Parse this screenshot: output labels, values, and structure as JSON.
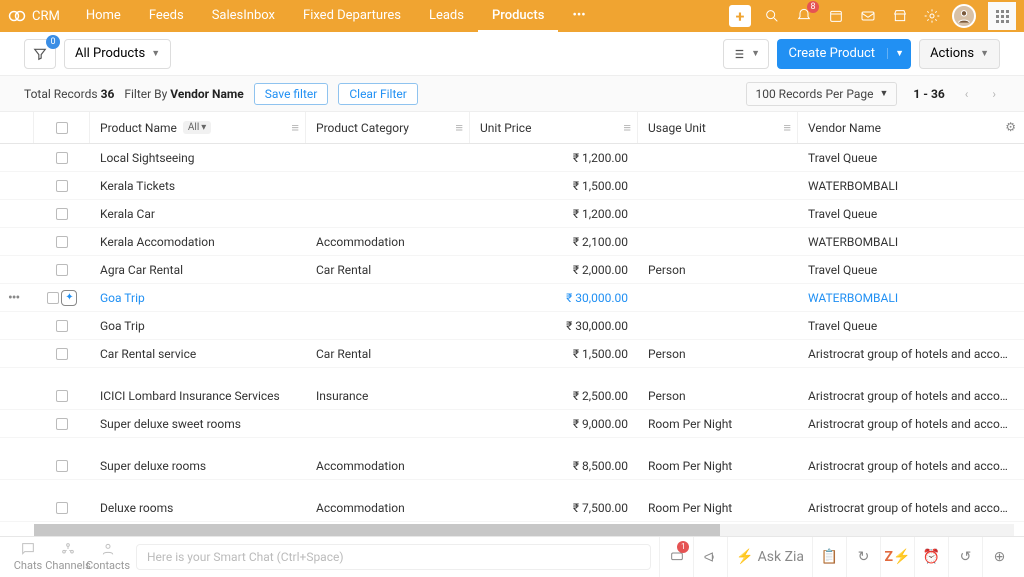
{
  "header": {
    "brand": "CRM",
    "nav": [
      "Home",
      "Feeds",
      "SalesInbox",
      "Fixed Departures",
      "Leads",
      "Products",
      "•••"
    ],
    "active_index": 5,
    "notif_badge": "8"
  },
  "actionbar": {
    "view_label": "All Products",
    "filter_dot": "0",
    "create_label": "Create Product",
    "actions_label": "Actions"
  },
  "filterrow": {
    "total_label": "Total Records",
    "total_count": "36",
    "filter_label": "Filter By",
    "filter_value": "Vendor Name",
    "save_label": "Save filter",
    "clear_label": "Clear Filter",
    "perpage_label": "100 Records Per Page",
    "range": "1 - 36"
  },
  "columns": {
    "name": "Product Name",
    "name_tag": "All",
    "category": "Product Category",
    "price": "Unit Price",
    "usage": "Usage Unit",
    "vendor": "Vendor Name"
  },
  "rows": [
    {
      "name": "Local Sightseeing",
      "category": "",
      "price": "₹ 1,200.00",
      "usage": "",
      "vendor": "Travel Queue"
    },
    {
      "name": "Kerala Tickets",
      "category": "",
      "price": "₹ 1,500.00",
      "usage": "",
      "vendor": "WATERBOMBALI"
    },
    {
      "name": "Kerala Car",
      "category": "",
      "price": "₹ 1,200.00",
      "usage": "",
      "vendor": "Travel Queue"
    },
    {
      "name": "Kerala Accomodation",
      "category": "Accommodation",
      "price": "₹ 2,100.00",
      "usage": "",
      "vendor": "WATERBOMBALI"
    },
    {
      "name": "Agra Car Rental",
      "category": "Car Rental",
      "price": "₹ 2,000.00",
      "usage": "Person",
      "vendor": "Travel Queue"
    },
    {
      "name": "Goa Trip",
      "category": "",
      "price": "₹ 30,000.00",
      "usage": "",
      "vendor": "WATERBOMBALI",
      "active": true
    },
    {
      "name": "Goa Trip",
      "category": "",
      "price": "₹ 30,000.00",
      "usage": "",
      "vendor": "Travel Queue"
    },
    {
      "name": "Car Rental service",
      "category": "Car Rental",
      "price": "₹ 1,500.00",
      "usage": "Person",
      "vendor": "Aristrocrat group of hotels and accomodat",
      "gap_after": true
    },
    {
      "name": "ICICI Lombard Insurance Services",
      "category": "Insurance",
      "price": "₹ 2,500.00",
      "usage": "Person",
      "vendor": "Aristrocrat group of hotels and accomodat"
    },
    {
      "name": "Super deluxe sweet rooms",
      "category": "",
      "price": "₹ 9,000.00",
      "usage": "Room Per Night",
      "vendor": "Aristrocrat group of hotels and accomodat",
      "gap_after": true
    },
    {
      "name": "Super deluxe rooms",
      "category": "Accommodation",
      "price": "₹ 8,500.00",
      "usage": "Room Per Night",
      "vendor": "Aristrocrat group of hotels and accomodat",
      "gap_after": true
    },
    {
      "name": "Deluxe rooms",
      "category": "Accommodation",
      "price": "₹ 7,500.00",
      "usage": "Room Per Night",
      "vendor": "Aristrocrat group of hotels and accomodat"
    }
  ],
  "bottombar": {
    "tabs": [
      "Chats",
      "Channels",
      "Contacts"
    ],
    "smartchat_placeholder": "Here is your Smart Chat (Ctrl+Space)",
    "askzia": "Ask Zia",
    "bell_badge": "1"
  }
}
